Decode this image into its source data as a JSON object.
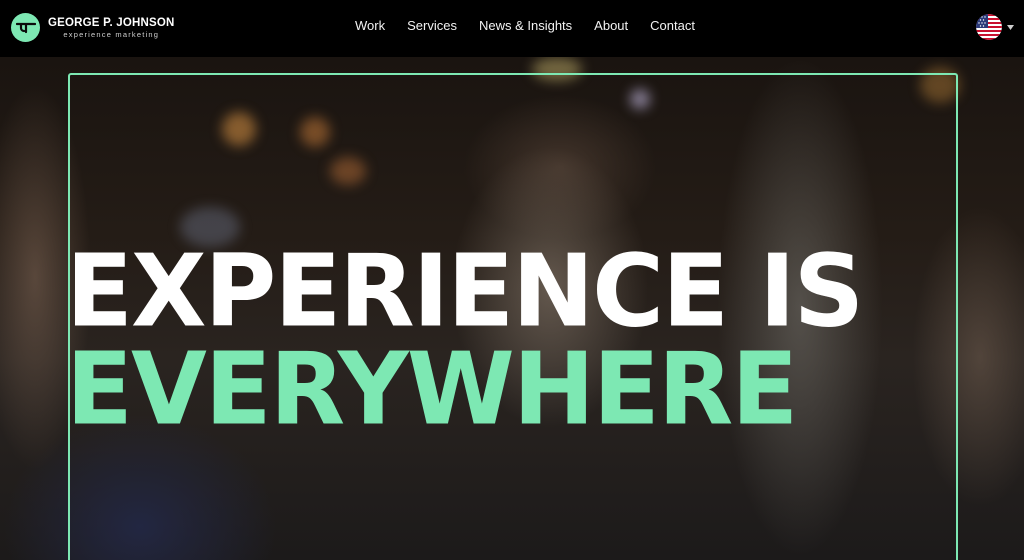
{
  "brand": {
    "name": "GEORGE P. JOHNSON",
    "tagline": "experience marketing",
    "logo_icon": "gpj-logo-icon"
  },
  "nav": {
    "items": [
      {
        "label": "Work"
      },
      {
        "label": "Services"
      },
      {
        "label": "News & Insights"
      },
      {
        "label": "About"
      },
      {
        "label": "Contact"
      }
    ]
  },
  "language": {
    "flag_icon": "us-flag-icon",
    "caret_icon": "chevron-down-icon"
  },
  "hero": {
    "headline_line1": "EXPERIENCE IS",
    "headline_line2": "EVERYWHERE"
  },
  "colors": {
    "accent": "#7de8b3",
    "nav_bg": "#000000",
    "text_primary": "#ffffff"
  }
}
